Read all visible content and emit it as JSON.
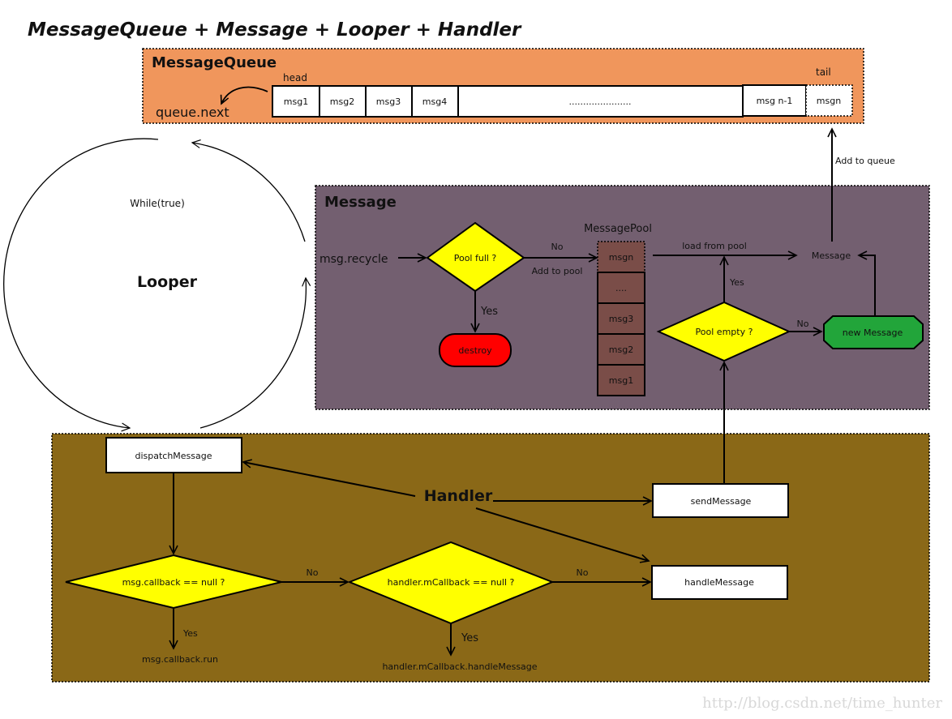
{
  "title": "MessageQueue + Message + Looper + Handler",
  "colors": {
    "queue_bg": "#f0965c",
    "message_bg": "#735f70",
    "handler_bg": "#8a6817",
    "decision": "#ffff00",
    "destroy": "#ff0000",
    "new_message": "#22a53a",
    "pool_cell": "#7a4d48",
    "box": "#ffffff"
  },
  "queue": {
    "label": "MessageQueue",
    "head_label": "head",
    "tail_label": "tail",
    "next_label": "queue.next",
    "cells": [
      "msg1",
      "msg2",
      "msg3",
      "msg4",
      "......................",
      "msg n-1",
      "msgn"
    ]
  },
  "looper": {
    "label": "Looper",
    "loop_label": "While(true)"
  },
  "message": {
    "label": "Message",
    "recycle_label": "msg.recycle",
    "pool_full": "Pool full ?",
    "yes": "Yes",
    "no": "No",
    "destroy": "destroy",
    "add_to_pool": "Add to pool",
    "pool_title": "MessagePool",
    "pool_cells": [
      "msgn",
      "....",
      "msg3",
      "msg2",
      "msg1"
    ],
    "load_from_pool": "load from pool",
    "message_node": "Message",
    "pool_empty": "Pool empty ?",
    "pool_empty_yes": "Yes",
    "pool_empty_no": "No",
    "new_message": "new Message",
    "add_to_queue": "Add to queue"
  },
  "handler": {
    "label": "Handler",
    "dispatch": "dispatchMessage",
    "send": "sendMessage",
    "handle": "handleMessage",
    "callback_check": "msg.callback == null ?",
    "callback_no": "No",
    "callback_yes": "Yes",
    "callback_run": "msg.callback.run",
    "mcallback_check": "handler.mCallback == null ?",
    "mcallback_no": "No",
    "mcallback_yes": "Yes",
    "mcallback_handle": "handler.mCallback.handleMessage"
  },
  "watermark": "http://blog.csdn.net/time_hunter"
}
